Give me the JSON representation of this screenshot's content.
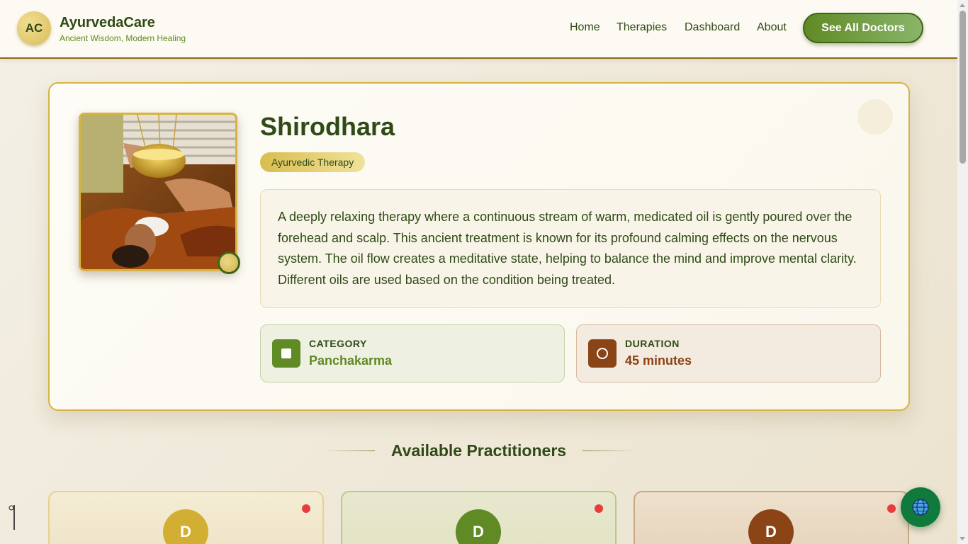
{
  "header": {
    "logo_initials": "AC",
    "brand_name": "AyurvedaCare",
    "tagline": "Ancient Wisdom, Modern Healing",
    "nav": [
      "Home",
      "Therapies",
      "Dashboard",
      "About"
    ],
    "cta_label": "See All Doctors"
  },
  "therapy": {
    "title": "Shirodhara",
    "tag": "Ayurvedic Therapy",
    "description": "A deeply relaxing therapy where a continuous stream of warm, medicated oil is gently poured over the forehead and scalp. This ancient treatment is known for its profound calming effects on the nervous system. The oil flow creates a meditative state, helping to balance the mind and improve mental clarity. Different oils are used based on the condition being treated.",
    "category_label": "CATEGORY",
    "category_value": "Panchakarma",
    "duration_label": "DURATION",
    "duration_value": "45 minutes"
  },
  "practitioners": {
    "heading": "Available Practitioners",
    "cards": [
      {
        "initial": "D",
        "color": "#d2ae33"
      },
      {
        "initial": "D",
        "color": "#5f8a24"
      },
      {
        "initial": "D",
        "color": "#8a4416"
      }
    ]
  },
  "icons": {
    "language": "globe-icon",
    "category": "square-icon",
    "duration": "clock-icon"
  },
  "colors": {
    "primary_green": "#5f8a24",
    "dark_green": "#2f4a16",
    "gold": "#d6b441",
    "brown": "#8a4416",
    "status_red": "#e83b3b",
    "globe_green": "#0f7a3c"
  }
}
